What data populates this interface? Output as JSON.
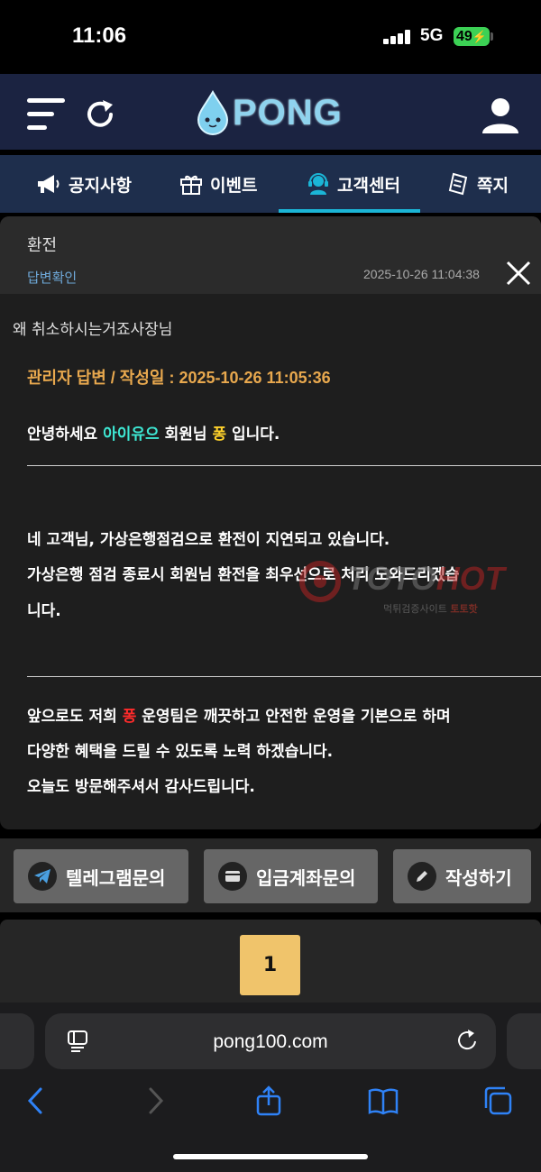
{
  "status_bar": {
    "time": "11:06",
    "network": "5G",
    "battery": "49",
    "battery_color": "#3cd155"
  },
  "header": {
    "logo_text": "PONG",
    "menu_icon": "hamburger-icon",
    "refresh_icon": "refresh-icon",
    "user_icon": "user-icon"
  },
  "tabs": [
    {
      "label": "공지사항",
      "icon": "megaphone-icon",
      "active": false
    },
    {
      "label": "이벤트",
      "icon": "gift-icon",
      "active": false
    },
    {
      "label": "고객센터",
      "icon": "support-agent-icon",
      "active": true
    },
    {
      "label": "쪽지",
      "icon": "note-icon",
      "active": false
    }
  ],
  "message": {
    "title": "환전",
    "status": "답변확인",
    "datetime": "2025-10-26 11:04:38",
    "question": "왜 취소하시는거죠사장님",
    "answer_meta": "관리자 답변 / 작성일 : 2025-10-26 11:05:36",
    "greeting": {
      "before": "안녕하세요 ",
      "member": "아이유으",
      "middle": " 회원님 ",
      "site": "퐁",
      "after": " 입니다."
    },
    "body_lines": [
      "네 고객님, 가상은행점검으로 환전이 지연되고 있습니다.",
      "가상은행 점검 종료시 회원님 환전을 최우선으로 처리 도와드리겠습",
      "니다."
    ],
    "closing": {
      "line1_before": "앞으로도 저희 ",
      "line1_site": "퐁",
      "line1_after": " 운영팀은 깨끗하고 안전한 운영을 기본으로 하며",
      "line2": "다양한 혜택을 드릴 수 있도록 노력 하겠습니다.",
      "line3": "오늘도 방문해주셔서 감사드립니다."
    },
    "watermark": {
      "brand": "TOTO",
      "brand_hot": "HOT",
      "sub": "먹튀검증사이트 ",
      "sub_brand": "토토핫"
    }
  },
  "buttons": {
    "telegram": "텔레그램문의",
    "deposit": "입금계좌문의",
    "write": "작성하기"
  },
  "pagination": {
    "current": "1"
  },
  "browser": {
    "url": "pong100.com"
  },
  "colors": {
    "header_bg": "#1b2341",
    "tab_bg": "#1e2e4c",
    "tab_active": "#1bb5d6",
    "answer_meta": "#e8a84e",
    "page_active": "#f0c46b"
  }
}
